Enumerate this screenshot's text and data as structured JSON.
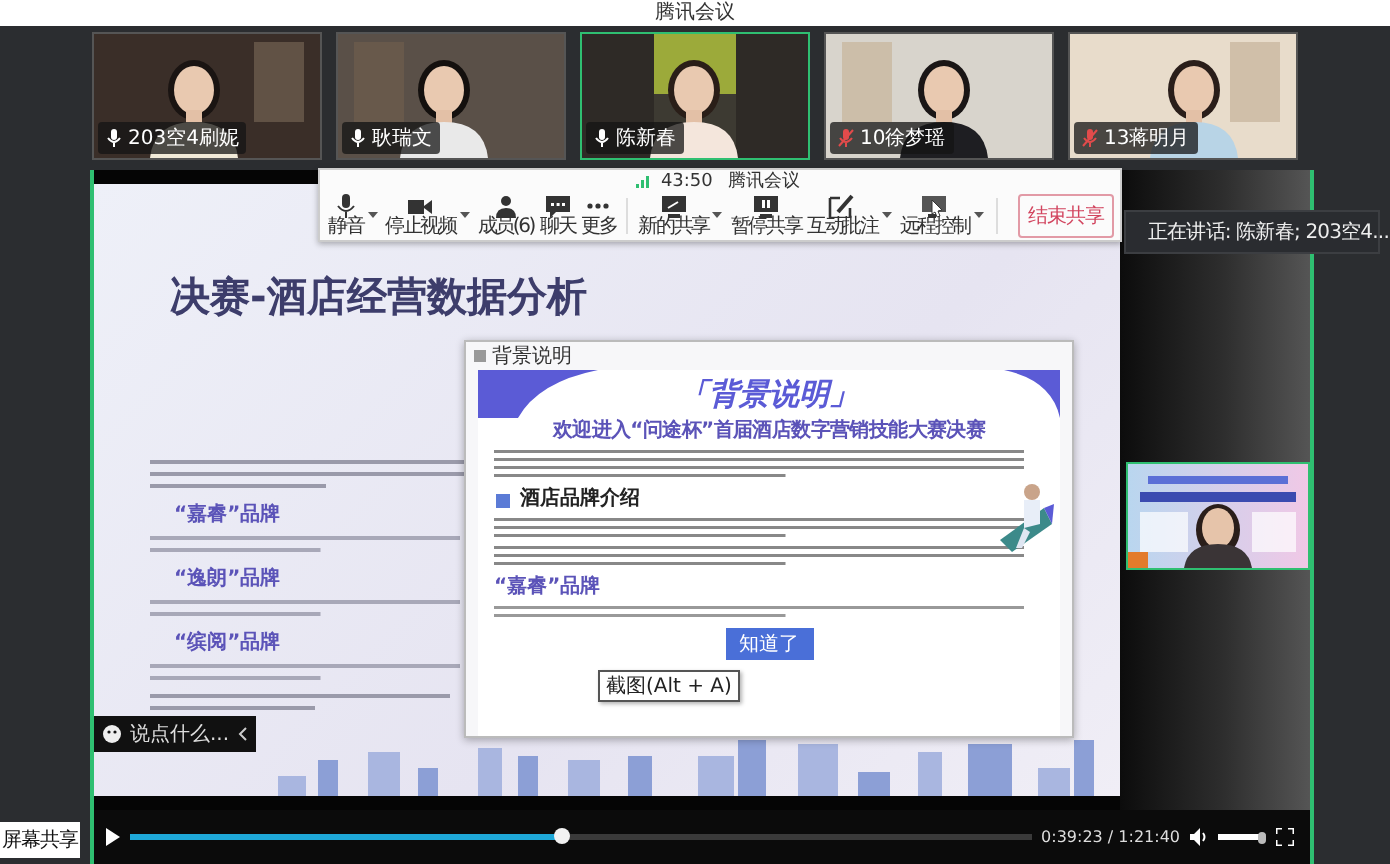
{
  "window": {
    "title": "腾讯会议"
  },
  "participants": [
    {
      "name": "203空4刷妮",
      "muted": false,
      "active": false
    },
    {
      "name": "耿瑞文",
      "muted": false,
      "active": false
    },
    {
      "name": "陈新春",
      "muted": false,
      "active": true
    },
    {
      "name": "10徐梦瑶",
      "muted": true,
      "active": false
    },
    {
      "name": "13蒋明月",
      "muted": true,
      "active": false
    }
  ],
  "meeting_bar": {
    "time": "43:50",
    "title": "腾讯会议"
  },
  "toolbar": [
    {
      "kind": "mic",
      "label": "静音",
      "dropdown": true
    },
    {
      "kind": "camera",
      "label": "停止视频",
      "dropdown": true
    },
    {
      "kind": "members",
      "label": "成员(6)",
      "dropdown": false
    },
    {
      "kind": "chat",
      "label": "聊天",
      "dropdown": false
    },
    {
      "kind": "more",
      "label": "更多",
      "dropdown": false
    },
    {
      "kind": "share",
      "label": "新的共享",
      "dropdown": true
    },
    {
      "kind": "pause",
      "label": "暂停共享",
      "dropdown": false
    },
    {
      "kind": "annotate",
      "label": "互动批注",
      "dropdown": true
    },
    {
      "kind": "remote",
      "label": "远程控制",
      "dropdown": true
    }
  ],
  "end_share_button": "结束共享",
  "slide": {
    "title": "决赛-酒店经营数据分析",
    "brands": [
      "“嘉睿”品牌",
      "“逸朗”品牌",
      "“缤阅”品牌"
    ]
  },
  "chat": {
    "placeholder": "说点什么..."
  },
  "popup": {
    "title": "背景说明",
    "banner": "「背景说明」",
    "headline": "欢迎进入“问途杯”首届酒店数字营销技能大赛决赛",
    "section": "酒店品牌介绍",
    "brand": "“嘉睿”品牌",
    "button": "知道了",
    "tooltip": "截图(Alt + A)"
  },
  "speaker_bar": {
    "text": "正在讲话: 陈新春; 203空4..."
  },
  "screen_share_label": "屏幕共享",
  "player": {
    "playing": false,
    "progress": {
      "level": 0.48
    },
    "time": "0:39:23 / 1:21:40",
    "volume": {
      "level": 0.9
    }
  }
}
